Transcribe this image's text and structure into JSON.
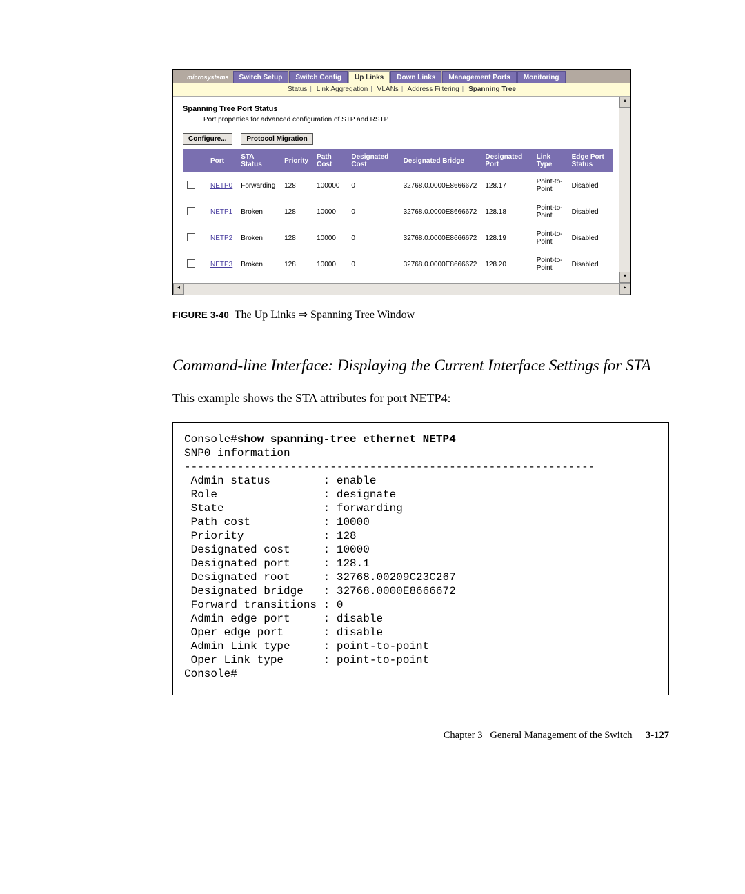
{
  "window": {
    "logo": "microsystems",
    "tabs": [
      "Switch Setup",
      "Switch Config",
      "Up Links",
      "Down Links",
      "Management Ports",
      "Monitoring"
    ],
    "active_tab_index": 2,
    "subtabs": [
      "Status",
      "Link Aggregation",
      "VLANs",
      "Address Filtering",
      "Spanning Tree"
    ],
    "active_subtab_index": 4,
    "section_title": "Spanning Tree Port Status",
    "section_subtitle": "Port properties for advanced configuration of STP and RSTP",
    "buttons": {
      "configure": "Configure...",
      "protocol_migration": "Protocol Migration"
    },
    "columns": [
      "",
      "Port",
      "STA Status",
      "Priority",
      "Path Cost",
      "Designated Cost",
      "Designated Bridge",
      "Designated Port",
      "Link Type",
      "Edge Port Status"
    ],
    "rows": [
      {
        "port": "NETP0",
        "sta": "Forwarding",
        "priority": "128",
        "path_cost": "100000",
        "des_cost": "0",
        "des_bridge": "32768.0.0000E8666672",
        "des_port": "128.17",
        "link": "Point-to-Point",
        "edge": "Disabled"
      },
      {
        "port": "NETP1",
        "sta": "Broken",
        "priority": "128",
        "path_cost": "10000",
        "des_cost": "0",
        "des_bridge": "32768.0.0000E8666672",
        "des_port": "128.18",
        "link": "Point-to-Point",
        "edge": "Disabled"
      },
      {
        "port": "NETP2",
        "sta": "Broken",
        "priority": "128",
        "path_cost": "10000",
        "des_cost": "0",
        "des_bridge": "32768.0.0000E8666672",
        "des_port": "128.19",
        "link": "Point-to-Point",
        "edge": "Disabled"
      },
      {
        "port": "NETP3",
        "sta": "Broken",
        "priority": "128",
        "path_cost": "10000",
        "des_cost": "0",
        "des_bridge": "32768.0.0000E8666672",
        "des_port": "128.20",
        "link": "Point-to-Point",
        "edge": "Disabled"
      }
    ]
  },
  "figure": {
    "label": "FIGURE 3-40",
    "caption_a": "The Up Links ",
    "arrow": "⇒",
    "caption_b": " Spanning Tree Window"
  },
  "cli_heading": "Command-line Interface: Displaying the Current Interface Settings for STA",
  "body_para": "This example shows the STA attributes for port NETP4:",
  "console": {
    "prompt": "Console#",
    "command": "show spanning-tree ethernet NETP4",
    "info_line": "SNP0 information",
    "divider": "--------------------------------------------------------------",
    "lines": [
      " Admin status        : enable",
      " Role                : designate",
      " State               : forwarding",
      " Path cost           : 10000",
      " Priority            : 128",
      " Designated cost     : 10000",
      " Designated port     : 128.1",
      " Designated root     : 32768.00209C23C267",
      " Designated bridge   : 32768.0000E8666672",
      " Forward transitions : 0",
      " Admin edge port     : disable",
      " Oper edge port      : disable",
      " Admin Link type     : point-to-point",
      " Oper Link type      : point-to-point"
    ],
    "end_prompt": "Console#"
  },
  "footer": {
    "chapter": "Chapter 3",
    "title": "General Management of the Switch",
    "page": "3-127"
  }
}
